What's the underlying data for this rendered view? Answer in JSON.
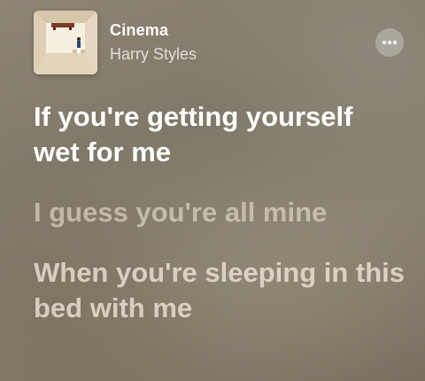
{
  "now_playing": {
    "title": "Cinema",
    "artist": "Harry Styles",
    "artwork_icon": "album-artwork",
    "more_icon": "ellipsis-icon"
  },
  "lyrics": [
    {
      "text": "If you're getting yourself wet for me",
      "state": "active"
    },
    {
      "text": "I guess you're all mine",
      "state": "inactive"
    },
    {
      "text": "When you're sleeping in this bed with me",
      "state": "upcoming"
    }
  ],
  "colors": {
    "active_lyric": "#ffffff",
    "inactive_lyric": "#f5ecde"
  }
}
